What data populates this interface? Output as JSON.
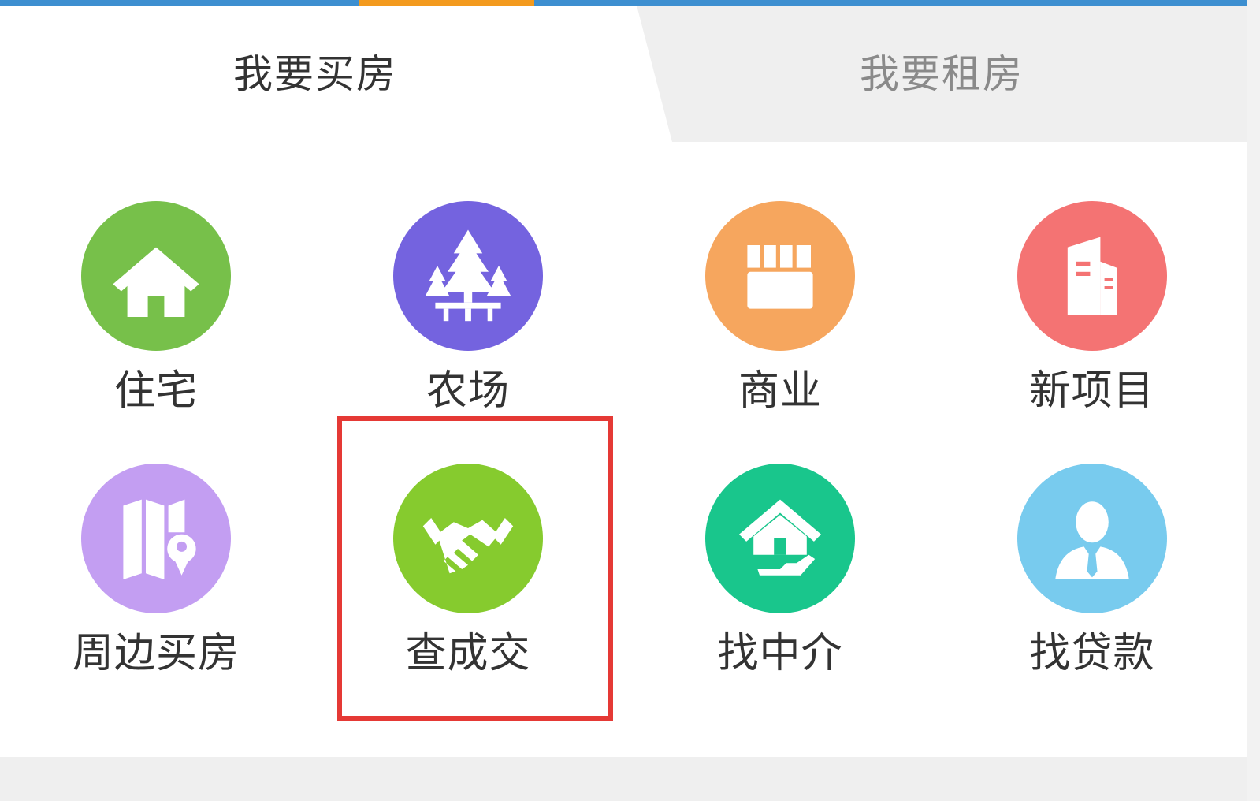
{
  "tabs": [
    {
      "label": "我要买房",
      "active": true
    },
    {
      "label": "我要租房",
      "active": false
    }
  ],
  "categories": [
    {
      "label": "住宅",
      "icon": "house-icon",
      "color": "#77c04a"
    },
    {
      "label": "农场",
      "icon": "trees-icon",
      "color": "#7463df"
    },
    {
      "label": "商业",
      "icon": "storefront-icon",
      "color": "#f6a65e"
    },
    {
      "label": "新项目",
      "icon": "buildings-icon",
      "color": "#f47373"
    },
    {
      "label": "周边买房",
      "icon": "map-pin-icon",
      "color": "#c39ef2"
    },
    {
      "label": "查成交",
      "icon": "handshake-icon",
      "color": "#86cb2e"
    },
    {
      "label": "找中介",
      "icon": "house-hand-icon",
      "color": "#19c68c"
    },
    {
      "label": "找贷款",
      "icon": "agent-icon",
      "color": "#78cbee"
    }
  ],
  "colors": {
    "top_bar": "#3d8fd0",
    "top_bar_accent": "#f39a1e",
    "highlight": "#e53935"
  }
}
